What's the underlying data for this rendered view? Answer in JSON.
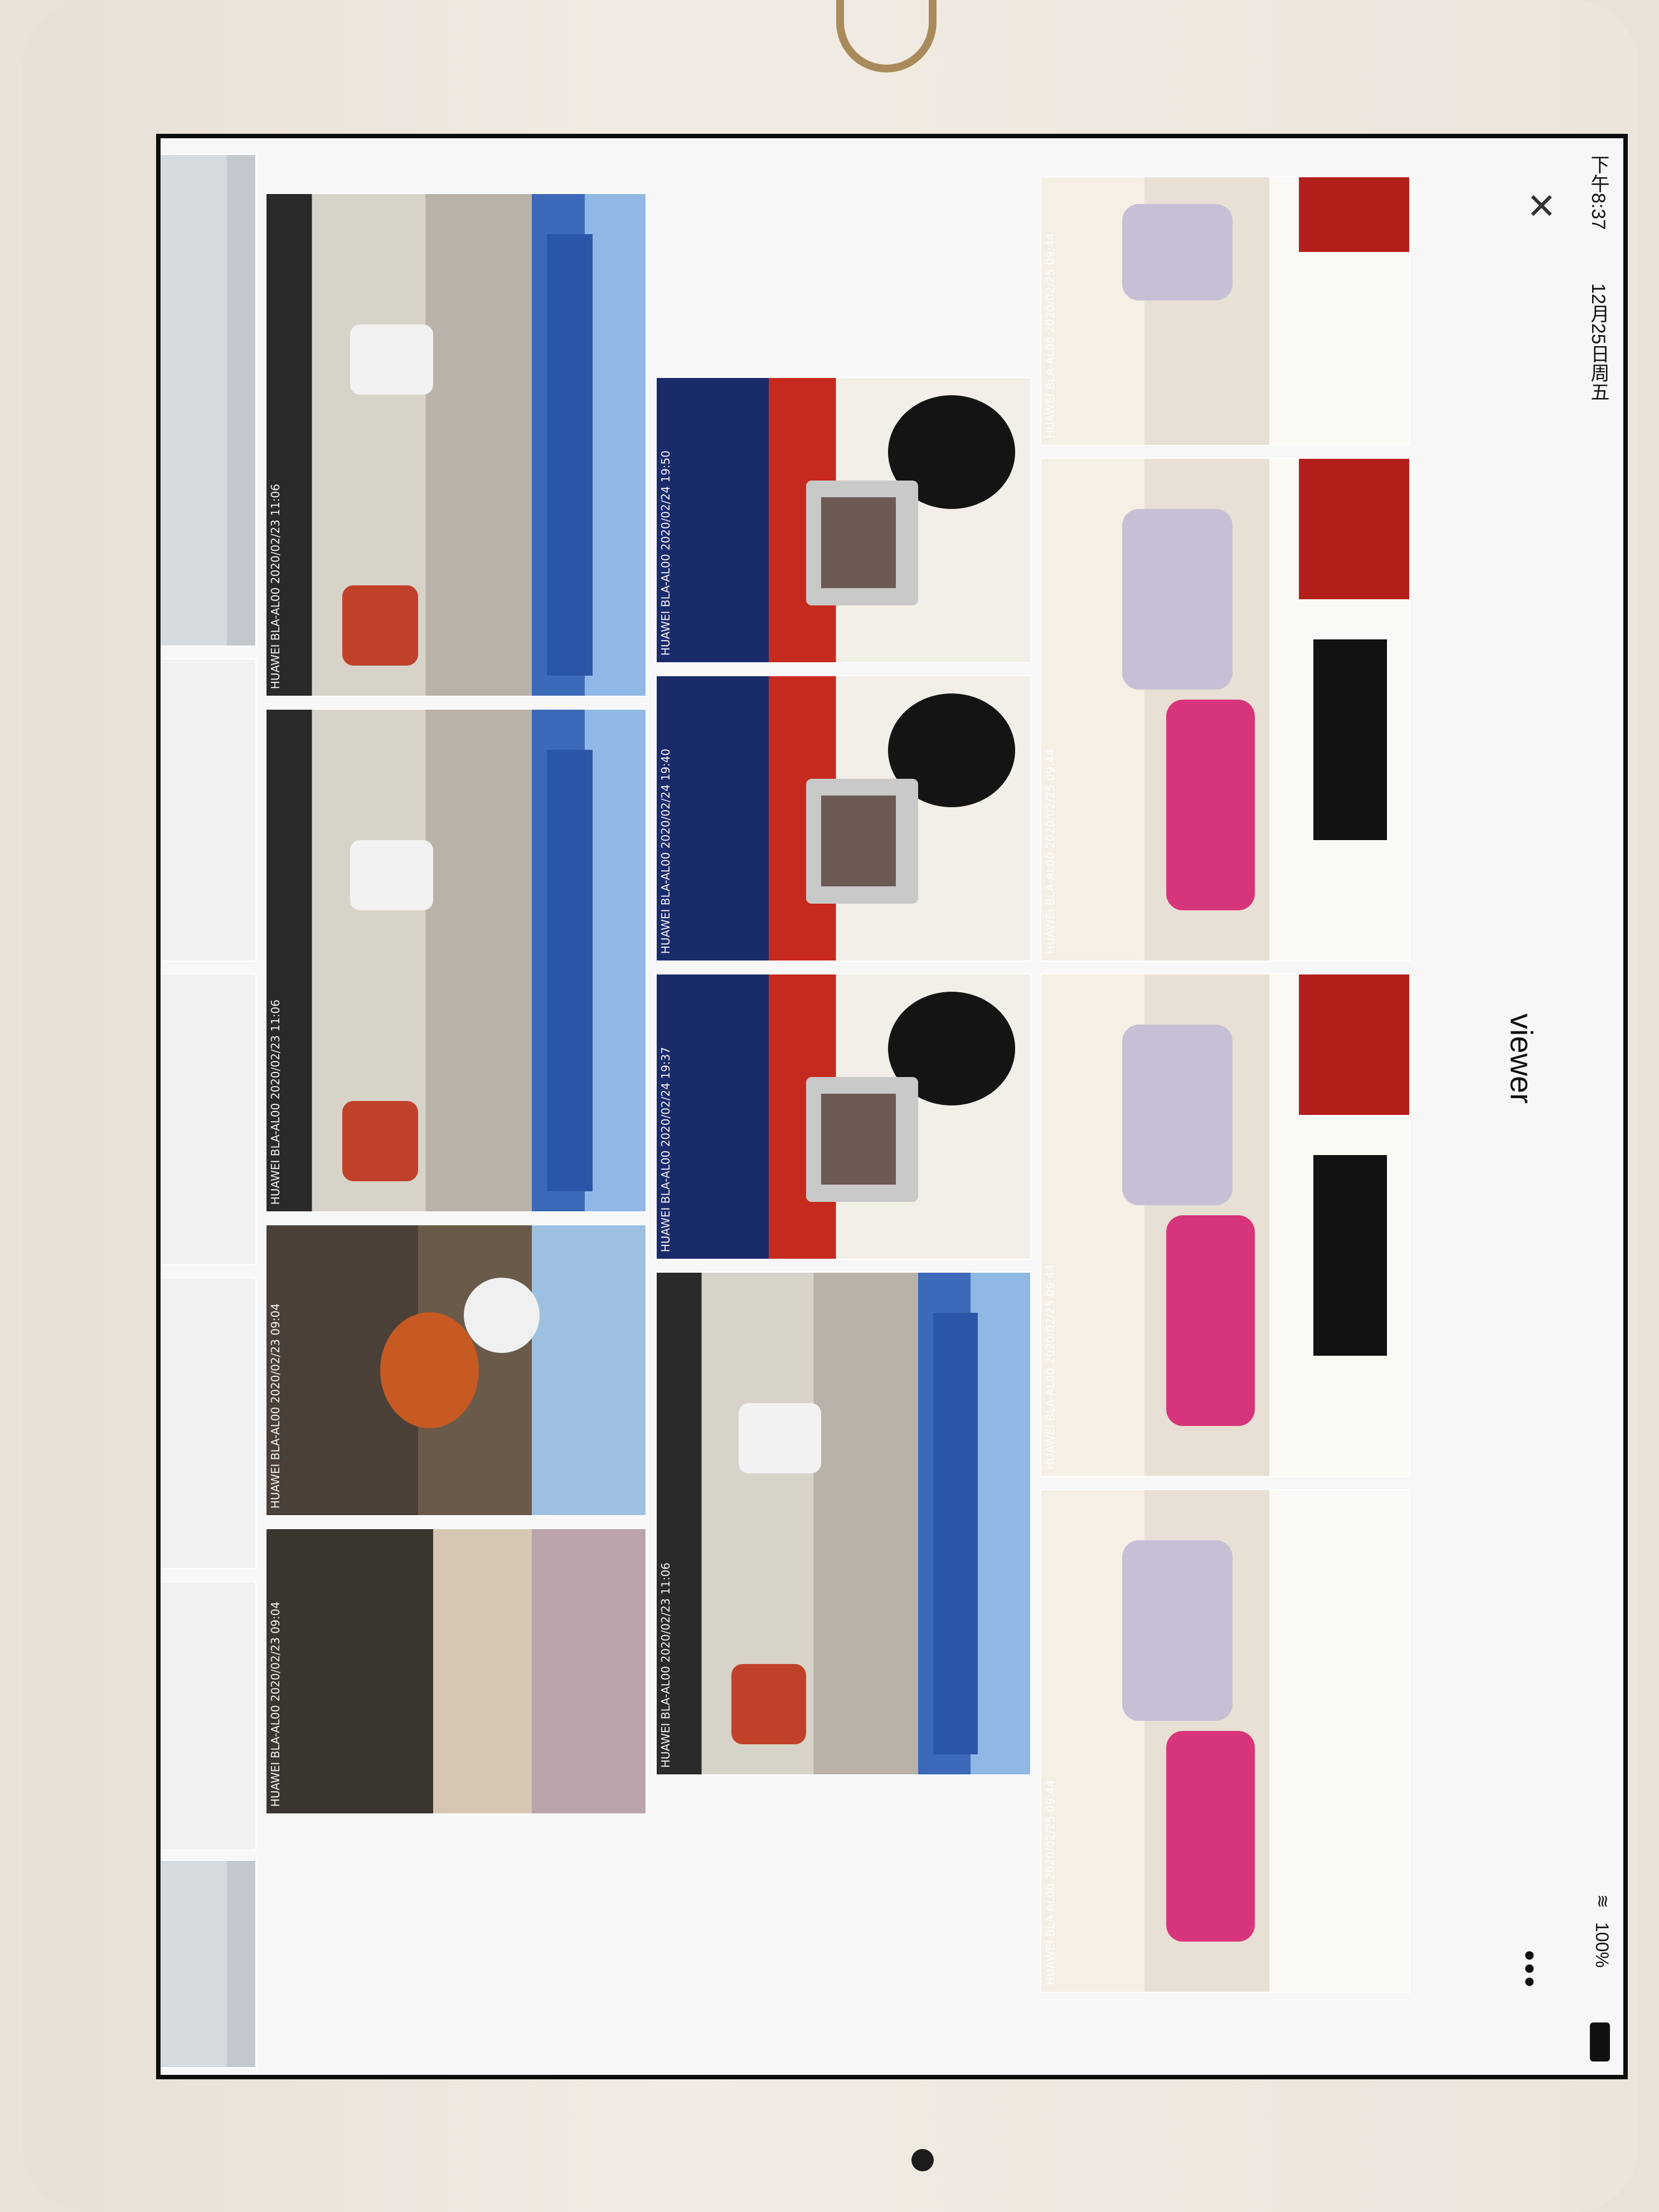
{
  "status_bar": {
    "time": "下午8:37",
    "date": "12月25日周五",
    "battery": "100%"
  },
  "nav": {
    "title": "viewer",
    "close_icon": "close-icon",
    "more_icon": "more-dots-icon"
  },
  "photos": {
    "col1": [
      "",
      "",
      "",
      "",
      "",
      ""
    ],
    "col2": [
      "HUAWEI BLA-AL00 2020/02/23 11:06",
      "HUAWEI BLA-AL00 2020/02/23 11:06",
      "HUAWEI BLA-AL00 2020/02/23 09:04",
      "HUAWEI BLA-AL00 2020/02/23 09:04"
    ],
    "col3": [
      "HUAWEI BLA-AL00 2020/02/24 19:50",
      "HUAWEI BLA-AL00 2020/02/24 19:40",
      "HUAWEI BLA-AL00 2020/02/24 19:37",
      "HUAWEI BLA-AL00 2020/02/23 11:06"
    ],
    "col4": [
      "HUAWEI BLA-AL00 2020/02/25 09:44",
      "HUAWEI BLA-AL00 2020/02/25 09:44",
      "HUAWEI BLA-AL00 2020/02/25 09:44",
      "HUAWEI BLA-AL00 2020/02/25 09:44"
    ]
  }
}
